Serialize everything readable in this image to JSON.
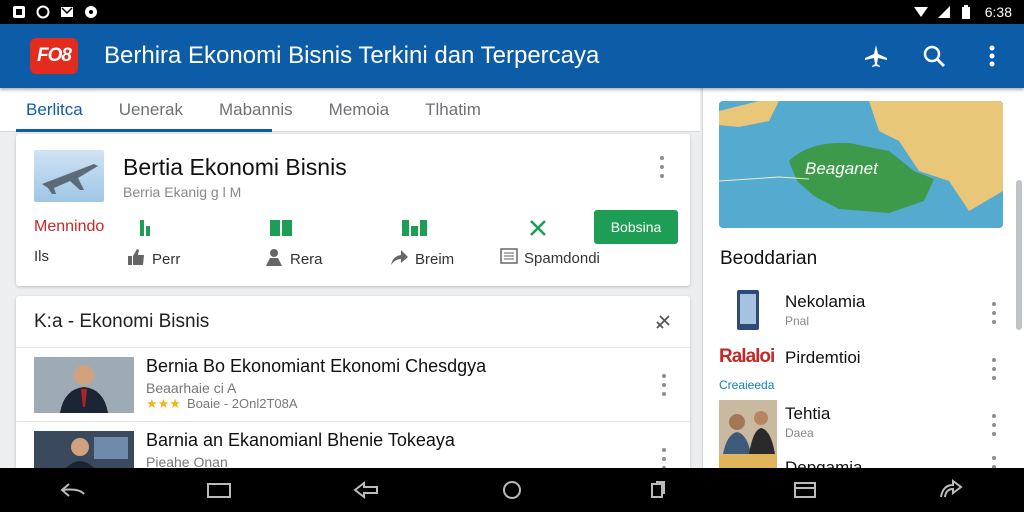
{
  "status_bar": {
    "time": "6:38"
  },
  "app_bar": {
    "logo_text": "FO8",
    "title": "Berhira Ekonomi Bisnis Terkini dan Terpercaya"
  },
  "tabs": [
    {
      "label": "Berlitca"
    },
    {
      "label": "Uenerak"
    },
    {
      "label": "Mabannis"
    },
    {
      "label": "Memoia"
    },
    {
      "label": "Tlhatim"
    }
  ],
  "card1": {
    "title": "Bertia Ekonomi Bisnis",
    "subtitle": "Berria Ekanig g l M",
    "row1_label": "Mennindo",
    "button_label": "Bobsina",
    "row2_label": "Ils",
    "actions": [
      {
        "label": "Perr",
        "icon": "thumb-icon"
      },
      {
        "label": "Rera",
        "icon": "person-icon"
      },
      {
        "label": "Breim",
        "icon": "share-icon"
      },
      {
        "label": "Spamdondi",
        "icon": "list-icon"
      }
    ]
  },
  "card2": {
    "heading": "K:a - Ekonomi Bisnis",
    "items": [
      {
        "title": "Bernia Bo Ekonomiant Ekonomi Chesdgya",
        "subtitle": "Beaarhaie ci A",
        "meta": "Boaie - 2Onl2T08A"
      },
      {
        "title": "Barnia an Ekanomianl Bhenie Tokeaya",
        "subtitle": "Pieahe Onan",
        "meta": ""
      }
    ]
  },
  "sidebar": {
    "map_label": "Beaganet",
    "section_title": "Beoddarian",
    "items": [
      {
        "title": "Nekolamia",
        "subtitle": "Pnal"
      },
      {
        "title": "Pirdemtioi",
        "subtitle": "Creaieeda",
        "thumb_text": "Ralaloi"
      },
      {
        "title": "Tehtia",
        "subtitle": "Daea"
      },
      {
        "title": "Depgamia",
        "subtitle": ""
      }
    ]
  },
  "colors": {
    "primary": "#0d5ca8",
    "accent_green": "#1e9e55",
    "accent_red": "#e32b1e"
  }
}
